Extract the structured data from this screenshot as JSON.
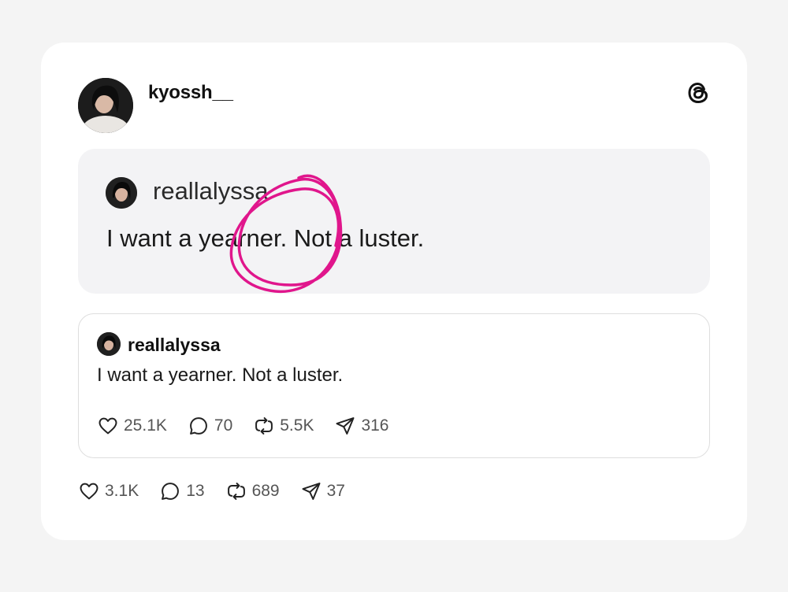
{
  "post": {
    "author": "kyossh__",
    "avatar_icon": "profile-photo",
    "logo_icon": "threads-logo",
    "screenshot": {
      "username": "reallalyssa",
      "text": "I want a yearner. Not a luster.",
      "annotation_color": "#e0168c"
    },
    "quote": {
      "username": "reallalyssa",
      "text": "I want a yearner. Not a luster.",
      "stats": {
        "likes": "25.1K",
        "replies": "70",
        "reposts": "5.5K",
        "shares": "316"
      }
    },
    "stats": {
      "likes": "3.1K",
      "replies": "13",
      "reposts": "689",
      "shares": "37"
    }
  }
}
